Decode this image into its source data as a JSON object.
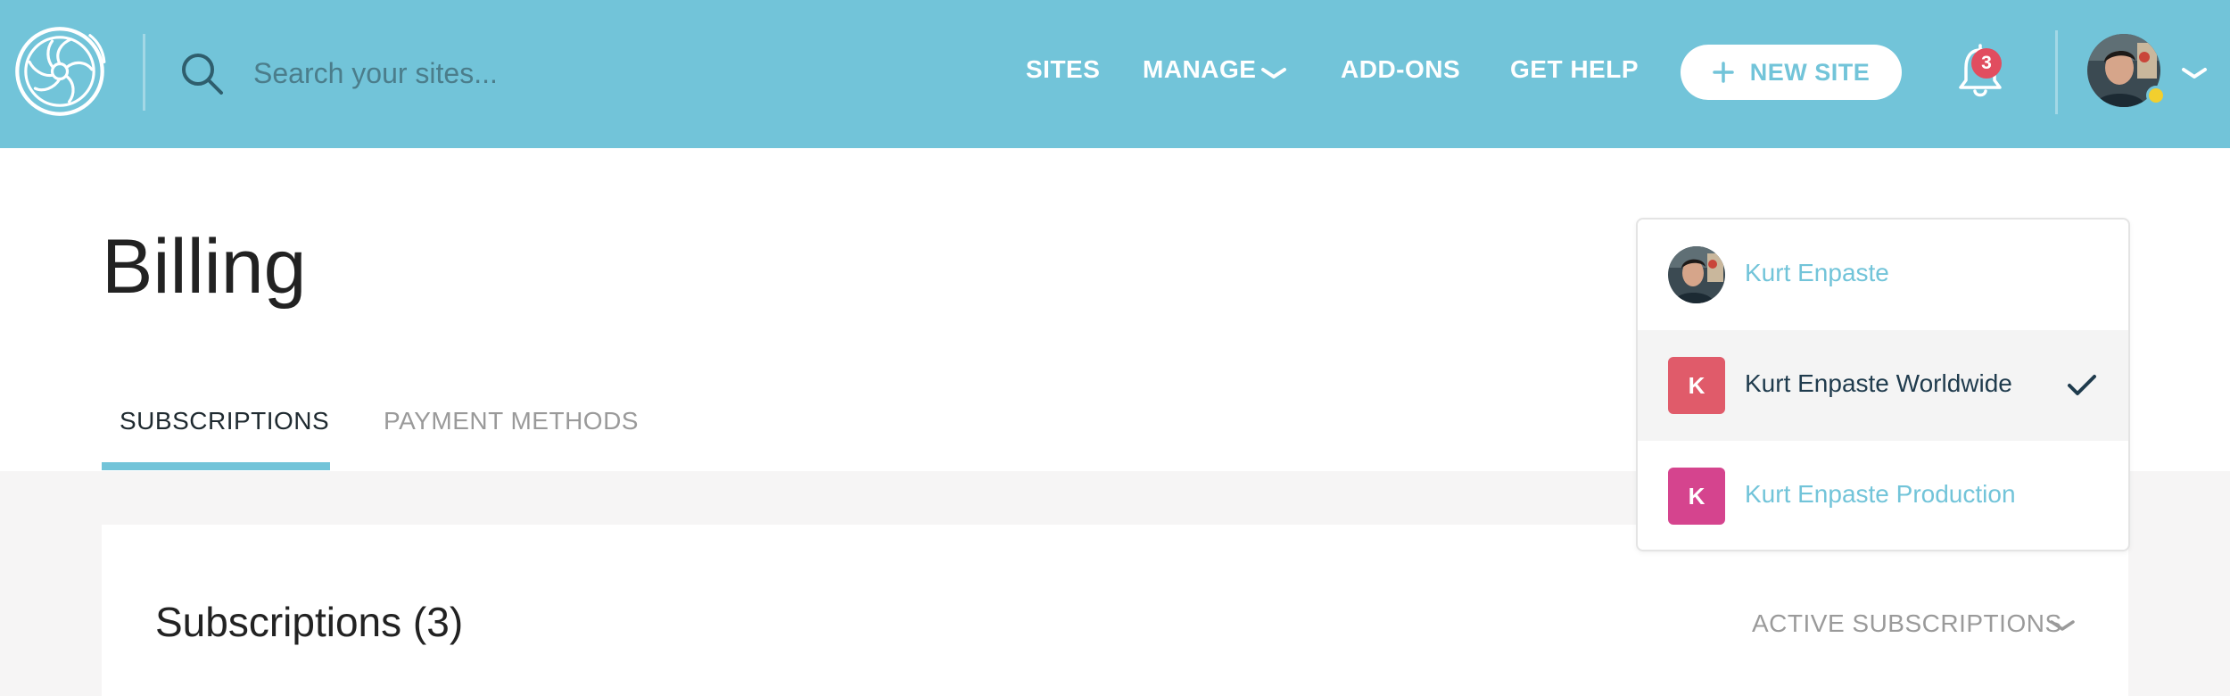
{
  "search": {
    "placeholder": "Search your sites..."
  },
  "nav": {
    "sites": "SITES",
    "manage": "MANAGE",
    "addons": "ADD-ONS",
    "help": "GET HELP",
    "new_site": "NEW SITE"
  },
  "notifications": {
    "count": "3"
  },
  "page": {
    "title": "Billing",
    "tabs": [
      {
        "label": "SUBSCRIPTIONS",
        "active": true
      },
      {
        "label": "PAYMENT METHODS",
        "active": false
      }
    ]
  },
  "card": {
    "title": "Subscriptions (3)",
    "filter": "ACTIVE SUBSCRIPTIONS"
  },
  "accounts": [
    {
      "name": "Kurt Enpaste",
      "type": "photo",
      "selected": false
    },
    {
      "name": "Kurt Enpaste Worldwide",
      "initial": "K",
      "color": "#e05b6a",
      "selected": true
    },
    {
      "name": "Kurt Enpaste Production",
      "initial": "K",
      "color": "#d5448e",
      "selected": false
    }
  ],
  "colors": {
    "brand": "#72c4d9",
    "link": "#72c4d9",
    "text_dark": "#1f3b4d",
    "badge": "#e14d5f",
    "status": "#f2cf2e"
  },
  "icons": {
    "logo": "flywheel-logo",
    "search": "search-icon",
    "chevron": "chevron-down-icon",
    "plus": "plus-icon",
    "bell": "bell-icon",
    "check": "checkmark-icon"
  }
}
